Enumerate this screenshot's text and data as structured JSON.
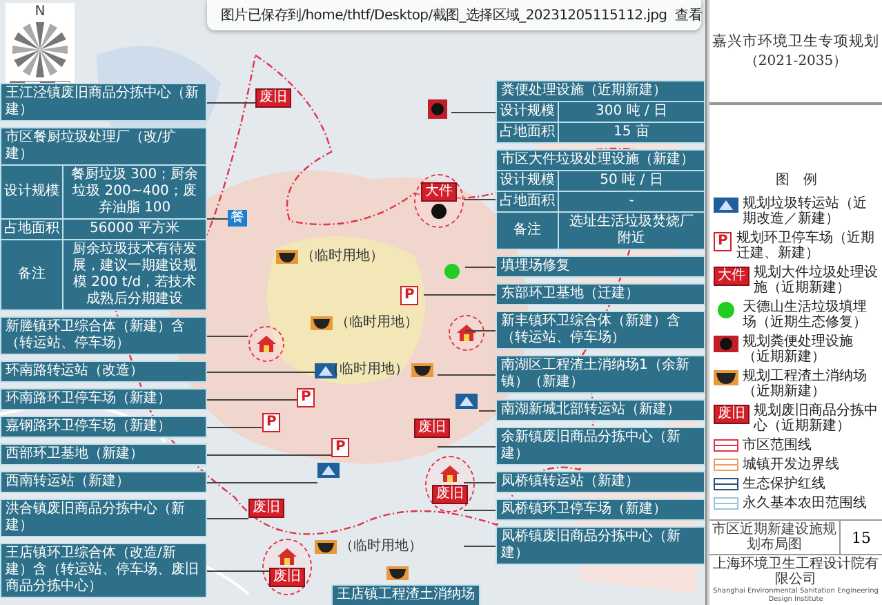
{
  "toast": {
    "message": "图片已保存到/home/thtf/Desktop/截图_选择区域_20231205115112.jpg",
    "action": "查看"
  },
  "compass": {
    "north": "N"
  },
  "left_callouts": [
    {
      "kind": "label",
      "text": "王江泾镇废旧商品分拣中心（新建）"
    },
    {
      "kind": "table",
      "title": "市区餐厨垃圾处理厂（改/扩建）",
      "rows": [
        {
          "label": "设计规模",
          "value": "餐厨垃圾 300；厨余垃圾 200~400；废弃油脂 100"
        },
        {
          "label": "占地面积",
          "value": "56000 平方米"
        },
        {
          "label": "备注",
          "value": "厨余垃圾技术有待发展，建议一期建设规模 200 t/d，若技术成熟后分期建设"
        }
      ]
    },
    {
      "kind": "label",
      "text": "新塍镇环卫综合体（新建）含（转运站、停车场）"
    },
    {
      "kind": "label",
      "text": "环南路转运站（改造）"
    },
    {
      "kind": "label",
      "text": "环南路环卫停车场（新建）"
    },
    {
      "kind": "label",
      "text": "嘉钢路环卫停车场（新建）"
    },
    {
      "kind": "label",
      "text": "西部环卫基地（新建）"
    },
    {
      "kind": "label",
      "text": "西南转运站（新建）"
    },
    {
      "kind": "label",
      "text": "洪合镇废旧商品分拣中心（新建）"
    },
    {
      "kind": "label",
      "text": "王店镇环卫综合体（改造/新建）含（转运站、停车场、废旧商品分拣中心）"
    }
  ],
  "right_callouts": [
    {
      "kind": "table",
      "title": "粪便处理设施（近期新建）",
      "rows": [
        {
          "label": "设计规模",
          "value": "300 吨 / 日"
        },
        {
          "label": "占地面积",
          "value": "15 亩"
        }
      ]
    },
    {
      "kind": "table",
      "title": "市区大件垃圾处理设施（新建）",
      "rows": [
        {
          "label": "设计规模",
          "value": "50 吨 / 日"
        },
        {
          "label": "占地面积",
          "value": "-"
        },
        {
          "label": "备注",
          "value": "选址生活垃圾焚烧厂附近"
        }
      ]
    },
    {
      "kind": "label",
      "text": "填埋场修复"
    },
    {
      "kind": "label",
      "text": "东部环卫基地（迁建）"
    },
    {
      "kind": "label",
      "text": "新丰镇环卫综合体（新建）含（转运站、停车场）"
    },
    {
      "kind": "label",
      "text": "南湖区工程渣土消纳场1（余新镇）（新建）"
    },
    {
      "kind": "label",
      "text": "南湖新城北部转运站（新建）"
    },
    {
      "kind": "label",
      "text": "余新镇废旧商品分拣中心（新建）"
    },
    {
      "kind": "label",
      "text": "凤桥镇转运站（新建）"
    },
    {
      "kind": "label",
      "text": "凤桥镇环卫停车场（新建）"
    },
    {
      "kind": "label",
      "text": "凤桥镇废旧商品分拣中心（新建）"
    }
  ],
  "bottom_callout": {
    "text": "王店镇工程渣土消纳场"
  },
  "markers": [
    {
      "kind": "recycling",
      "text": "废旧"
    },
    {
      "kind": "kitchen",
      "text": "餐"
    },
    {
      "kind": "complex"
    },
    {
      "kind": "muck",
      "note": "（临时用地）"
    },
    {
      "kind": "transfer"
    },
    {
      "kind": "parking",
      "text": "P"
    },
    {
      "kind": "parking",
      "text": "P"
    },
    {
      "kind": "parking",
      "text": "P"
    },
    {
      "kind": "transfer"
    },
    {
      "kind": "recycling",
      "text": "废旧"
    },
    {
      "kind": "complex",
      "text": "废旧"
    },
    {
      "kind": "muck"
    },
    {
      "kind": "feces"
    },
    {
      "kind": "bulky",
      "text": "大件"
    },
    {
      "kind": "landfill"
    },
    {
      "kind": "parking",
      "text": "P"
    },
    {
      "kind": "complex"
    },
    {
      "kind": "muck",
      "note": "（临时用地）"
    },
    {
      "kind": "transfer"
    },
    {
      "kind": "recycling",
      "text": "废旧"
    },
    {
      "kind": "complex",
      "text": "废旧"
    },
    {
      "kind": "muck",
      "note": "（临时用地）"
    },
    {
      "kind": "muck",
      "note": "（临时用地）"
    }
  ],
  "title": {
    "name": "嘉兴市环境卫生专项规划",
    "years": "（2021-2035）"
  },
  "legend": {
    "title": "图　例",
    "items": [
      {
        "kind": "transfer",
        "label": "规划垃圾转运站（近期改造／新建）"
      },
      {
        "kind": "parking",
        "symbol": "P",
        "label": "规划环卫停车场（近期迁建、新建）"
      },
      {
        "kind": "bulky",
        "symbol": "大件",
        "label": "规划大件垃圾处理设施（近期新建）"
      },
      {
        "kind": "landfill",
        "label": "天德山生活垃圾填埋场（近期生态修复）"
      },
      {
        "kind": "feces",
        "label": "规划粪便处理设施（近期新建）"
      },
      {
        "kind": "muck",
        "label": "规划工程渣土消纳场（近期新建）"
      },
      {
        "kind": "recycling",
        "symbol": "废旧",
        "label": "规划废旧商品分拣中心（近期新建）"
      },
      {
        "kind": "city-line",
        "label": "市区范围线"
      },
      {
        "kind": "town-line",
        "label": "城镇开发边界线"
      },
      {
        "kind": "eco-line",
        "label": "生态保护红线"
      },
      {
        "kind": "farm-line",
        "label": "永久基本农田范围线"
      }
    ]
  },
  "sheet": {
    "name": "市区近期新建设施规划布局图",
    "number": "15"
  },
  "company": {
    "name": "上海环境卫生工程设计院有限公司",
    "english": "Shanghai Environmental Sanitation Engineering Design Institute"
  }
}
